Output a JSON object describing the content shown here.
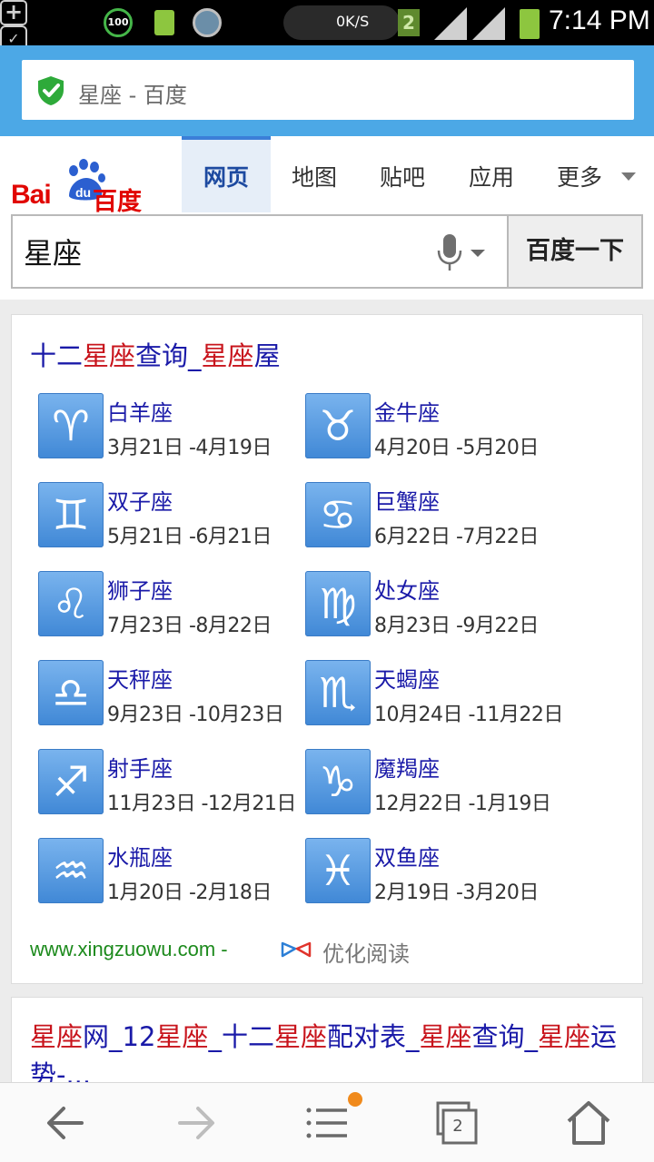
{
  "status_bar": {
    "battery_level_badge": "100",
    "net_speed": "0K/S",
    "sim_slot": "2",
    "time": "7:14 PM"
  },
  "address_bar": {
    "title": "星座 - 百度",
    "secure": true
  },
  "header": {
    "logo_text_latin": "Bai",
    "logo_text_paw": "du",
    "logo_text_cn": "百度",
    "tabs": [
      {
        "label": "网页",
        "active": true
      },
      {
        "label": "地图",
        "active": false
      },
      {
        "label": "贴吧",
        "active": false
      },
      {
        "label": "应用",
        "active": false
      },
      {
        "label": "更多",
        "active": false
      }
    ],
    "search": {
      "value": "星座",
      "button_label": "百度一下"
    }
  },
  "results": [
    {
      "title_parts": [
        "十二",
        "星座",
        "查询_",
        "星座",
        "屋"
      ],
      "zodiac": [
        {
          "name": "白羊座",
          "dates": "3月21日 -4月19日",
          "symbol": "♈"
        },
        {
          "name": "金牛座",
          "dates": "4月20日 -5月20日",
          "symbol": "♉"
        },
        {
          "name": "双子座",
          "dates": "5月21日 -6月21日",
          "symbol": "♊"
        },
        {
          "name": "巨蟹座",
          "dates": "6月22日 -7月22日",
          "symbol": "♋"
        },
        {
          "name": "狮子座",
          "dates": "7月23日 -8月22日",
          "symbol": "♌"
        },
        {
          "name": "处女座",
          "dates": "8月23日 -9月22日",
          "symbol": "♍"
        },
        {
          "name": "天秤座",
          "dates": "9月23日 -10月23日",
          "symbol": "♎"
        },
        {
          "name": "天蝎座",
          "dates": "10月24日 -11月22日",
          "symbol": "♏"
        },
        {
          "name": "射手座",
          "dates": "11月23日 -12月21日",
          "symbol": "♐"
        },
        {
          "name": "魔羯座",
          "dates": "12月22日 -1月19日",
          "symbol": "♑"
        },
        {
          "name": "水瓶座",
          "dates": "1月20日 -2月18日",
          "symbol": "♒"
        },
        {
          "name": "双鱼座",
          "dates": "2月19日 -3月20日",
          "symbol": "♓"
        }
      ],
      "url": "www.xingzuowu.com -",
      "reader_label": "优化阅读"
    },
    {
      "title_parts": [
        "星座",
        "网_12",
        "星座",
        "_十二",
        "星座",
        "配对表_",
        "星座",
        "查询_",
        "星座",
        "运势-..."
      ]
    }
  ],
  "toolbar": {
    "tabs_count": "2",
    "menu_badge": true
  },
  "colors": {
    "url_bar_bg": "#4ca8e6",
    "link_blue": "#1a1aa8",
    "highlight_red": "#c8141c",
    "url_green": "#1c8a1c",
    "zodiac_icon_blue": "#4088d6",
    "menu_badge_orange": "#f08a1c"
  },
  "icons": {
    "add": "plus-box-icon",
    "shield": "security-check-icon",
    "battery_saver": "battery-charging-icon",
    "ring": "ringtone-icon",
    "wifi": "wifi-icon",
    "signal": "cell-signal-icon",
    "battery": "battery-icon",
    "secure": "shield-check-icon",
    "mic": "microphone-icon",
    "reader": "reader-mode-icon",
    "back": "arrow-left-icon",
    "forward": "arrow-right-icon",
    "menu": "menu-lines-icon",
    "tabs": "tabs-icon",
    "home": "home-icon"
  }
}
